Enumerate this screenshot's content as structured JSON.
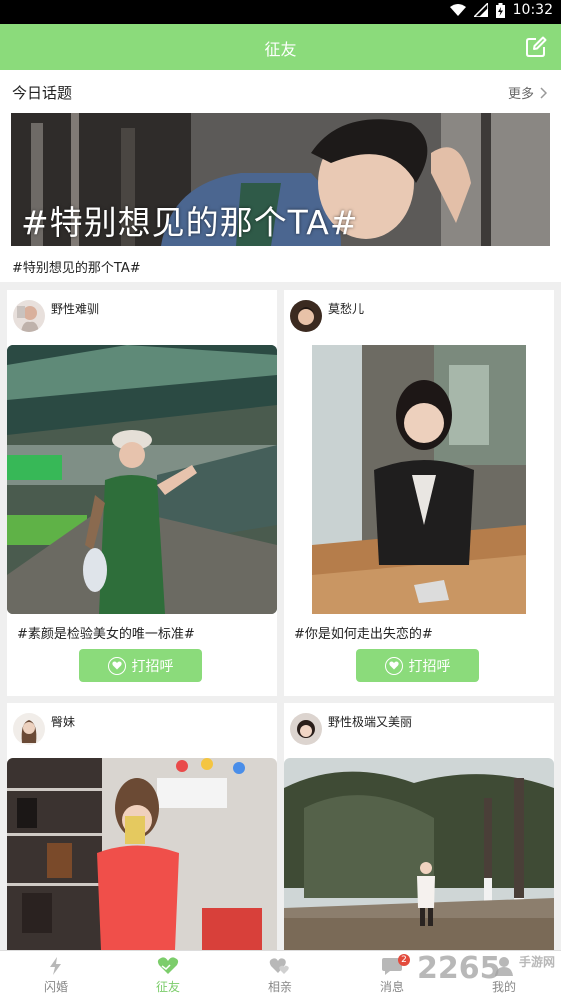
{
  "status_bar": {
    "time": "10:32"
  },
  "app_bar": {
    "title": "征友",
    "edit_icon": "edit-icon"
  },
  "topic": {
    "section_title": "今日话题",
    "more_label": "更多",
    "banner_text": "#特别想见的那个TA#",
    "caption": "#特别想见的那个TA#"
  },
  "posts": [
    {
      "username": "野性难驯",
      "caption": "#素颜是检验美女的唯一标准#",
      "button": "打招呼"
    },
    {
      "username": "莫愁儿",
      "caption": "#你是如何走出失恋的#",
      "button": "打招呼"
    },
    {
      "username": "臀妹"
    },
    {
      "username": "野性极端又美丽"
    }
  ],
  "tabs": [
    {
      "label": "闪婚",
      "icon": "lightning-icon"
    },
    {
      "label": "征友",
      "icon": "heart-hands-icon",
      "active": true
    },
    {
      "label": "相亲",
      "icon": "hearts-icon"
    },
    {
      "label": "消息",
      "icon": "chat-icon",
      "badge": "2"
    },
    {
      "label": "我的",
      "icon": "person-icon"
    }
  ],
  "watermark": {
    "number": "2265",
    "text": "手游网"
  },
  "colors": {
    "accent": "#8bdb7b",
    "tab_active": "#7ccd6b",
    "badge": "#e34b3d"
  }
}
